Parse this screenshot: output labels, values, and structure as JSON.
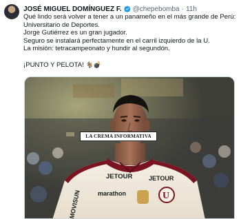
{
  "tweet": {
    "author_name": "JOSÉ MIGUEL DOMÍNGUEZ F.",
    "handle": "@chepebomba",
    "separator": "·",
    "time": "11h",
    "lines": [
      "Qué lindo será volver a tener a un panameño en el más grande de Perú:",
      "Universitario de Deportes.",
      "Jorge Gutiérrez es un gran jugador.",
      "Seguro se instalará perfectamente en el carril izquierdo de la U.",
      "La misión: tetracampeonato y hundir al segundón."
    ],
    "closing": "¡PUNTO Y PELOTA!",
    "closing_emoji": "🐐💣"
  },
  "media": {
    "watermark": "LA CREMA INFORMATIVA",
    "jersey": {
      "sponsor_top": "JETOUR",
      "sponsor_chest": "marathon",
      "sleeve_left": "MOVISUN",
      "sleeve_right": "JETOUR",
      "crest_letter": "U"
    }
  },
  "colors": {
    "verified": "#1d9bf0",
    "handle": "#536471",
    "jersey": "#f3ecdf",
    "trim": "#7a1422"
  }
}
